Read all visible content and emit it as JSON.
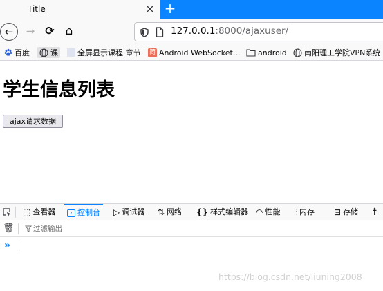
{
  "tab": {
    "title": "Title",
    "close_glyph": "×",
    "new_tab_glyph": "+"
  },
  "nav": {
    "back_glyph": "←",
    "forward_glyph": "→",
    "reload_glyph": "⟳",
    "home_glyph": "⌂",
    "url_host": "127.0.0.1",
    "url_rest": ":8000/ajaxuser/"
  },
  "bookmarks": [
    {
      "label": "百度",
      "icon": "paw-icon"
    },
    {
      "label": "课",
      "icon": "globe-icon"
    },
    {
      "label": "全屏显示课程 章节",
      "icon": "page-icon"
    },
    {
      "label": "Android WebSocket...",
      "icon": "jianshu-icon"
    },
    {
      "label": "android",
      "icon": "folder-icon"
    },
    {
      "label": "南阳理工学院VPN系统",
      "icon": "globe-icon"
    }
  ],
  "page": {
    "heading": "学生信息列表",
    "button_label": "ajax请求数据"
  },
  "devtools": {
    "tabs": [
      {
        "label": "查看器",
        "icon": "inspector-icon"
      },
      {
        "label": "控制台",
        "icon": "console-icon"
      },
      {
        "label": "调试器",
        "icon": "debugger-icon"
      },
      {
        "label": "网络",
        "icon": "network-icon"
      },
      {
        "label": "样式编辑器",
        "icon": "style-editor-icon"
      },
      {
        "label": "性能",
        "icon": "performance-icon"
      },
      {
        "label": "内存",
        "icon": "memory-icon"
      },
      {
        "label": "存储",
        "icon": "storage-icon"
      }
    ],
    "active_tab": "控制台",
    "filter_placeholder": "过滤输出",
    "prompt_glyph": "»"
  },
  "watermark": "https://blog.csdn.net/liuning2008",
  "colors": {
    "accent": "#0a84ff",
    "toolbar": "#f9f9fa"
  }
}
